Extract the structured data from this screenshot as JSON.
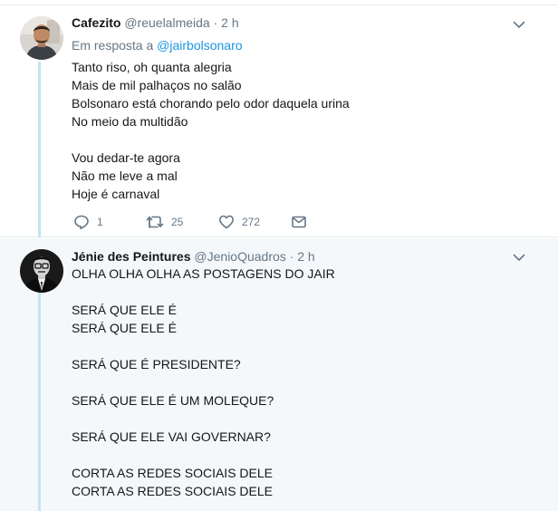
{
  "icons": {
    "reply": "reply-icon",
    "retweet": "retweet-icon",
    "like": "heart-icon",
    "message": "envelope-icon",
    "caret": "chevron-down-icon"
  },
  "colors": {
    "thread_line": "#c4e4f5",
    "link": "#1b95e0",
    "secondary_text": "#657786",
    "highlight_bg": "#f5f8fa"
  },
  "tweets": [
    {
      "name": "Cafezito",
      "handle": "@reuelalmeida",
      "dot": "·",
      "time": "2 h",
      "reply_prefix": "Em resposta a",
      "reply_mention": "@jairbolsonaro",
      "text": "Tanto riso, oh quanta alegria\nMais de mil palhaços no salão\nBolsonaro está chorando pelo odor daquela urina\nNo meio da multidão\n\nVou dedar-te agora\nNão me leve a mal\nHoje é carnaval",
      "reply_count": "1",
      "retweet_count": "25",
      "like_count": "272"
    },
    {
      "name": "Jénie des Peintures",
      "handle": "@JenioQuadros",
      "dot": "·",
      "time": "2 h",
      "text": "OLHA OLHA OLHA AS POSTAGENS DO JAIR\n\nSERÁ QUE ELE É\nSERÁ QUE ELE É\n\nSERÁ QUE É PRESIDENTE?\n\nSERÁ QUE ELE É UM MOLEQUE?\n\nSERÁ QUE ELE VAI GOVERNAR?\n\nCORTA AS REDES SOCIAIS DELE\nCORTA AS REDES SOCIAIS DELE"
    }
  ]
}
